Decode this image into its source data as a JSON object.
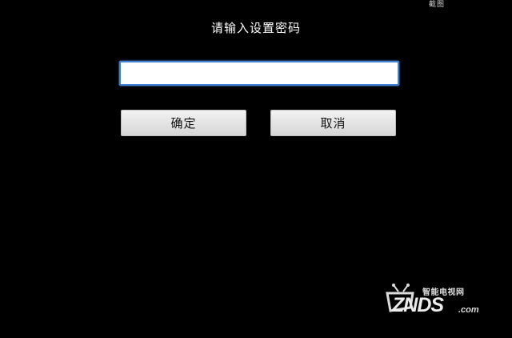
{
  "screen": {
    "top_label": "截图",
    "title": "请输入设置密码"
  },
  "password_field": {
    "value": "",
    "placeholder": ""
  },
  "buttons": {
    "confirm_label": "确定",
    "cancel_label": "取消"
  },
  "watermark": {
    "tagline": "智能电视网",
    "brand": "ZNDS",
    "domain": ".com"
  },
  "colors": {
    "background": "#000000",
    "focus_border": "#3f80d8"
  }
}
